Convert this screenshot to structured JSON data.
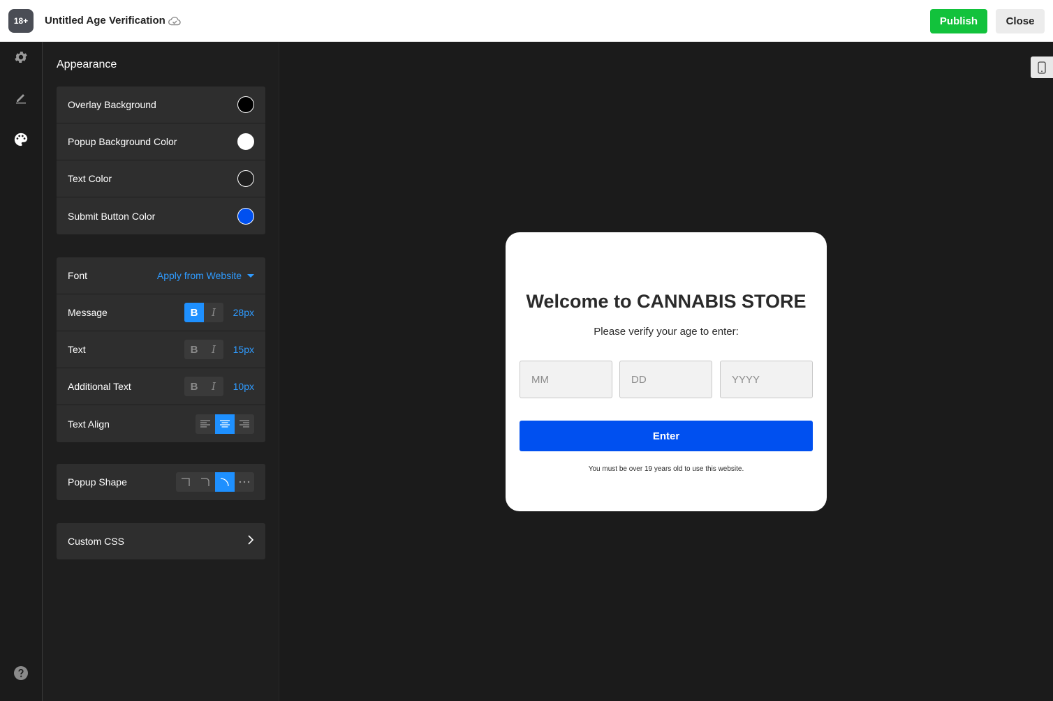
{
  "topbar": {
    "logo_text": "18+",
    "title": "Untitled Age Verification",
    "publish_label": "Publish",
    "close_label": "Close"
  },
  "rail": {
    "icons": [
      "gear-icon",
      "pen-icon",
      "palette-icon",
      "help-icon"
    ],
    "active": "palette-icon"
  },
  "panel": {
    "heading": "Appearance",
    "colors": [
      {
        "label": "Overlay Background",
        "color": "#000000"
      },
      {
        "label": "Popup Background Color",
        "color": "#ffffff"
      },
      {
        "label": "Text Color",
        "color": "#1e1e1e"
      },
      {
        "label": "Submit Button Color",
        "color": "#0050f0"
      }
    ],
    "font": {
      "label": "Font",
      "value": "Apply from Website"
    },
    "message": {
      "label": "Message",
      "bold": true,
      "italic": false,
      "size": "28px"
    },
    "text": {
      "label": "Text",
      "bold": false,
      "italic": false,
      "size": "15px"
    },
    "additional": {
      "label": "Additional Text",
      "bold": false,
      "italic": false,
      "size": "10px"
    },
    "align": {
      "label": "Text Align",
      "selected": "center"
    },
    "shape": {
      "label": "Popup Shape",
      "selected": "rounded-more"
    },
    "custom_css": {
      "label": "Custom CSS"
    },
    "bold_glyph": "B",
    "italic_glyph": "I"
  },
  "popup": {
    "message": "Welcome to CANNABIS STORE",
    "text": "Please verify your age to enter:",
    "mm_placeholder": "MM",
    "dd_placeholder": "DD",
    "yyyy_placeholder": "YYYY",
    "button_label": "Enter",
    "additional_text": "You must be over 19 years old to use this website."
  },
  "colors": {
    "publish": "#12c23c",
    "accent": "#1e90ff",
    "submit": "#0050f0"
  }
}
